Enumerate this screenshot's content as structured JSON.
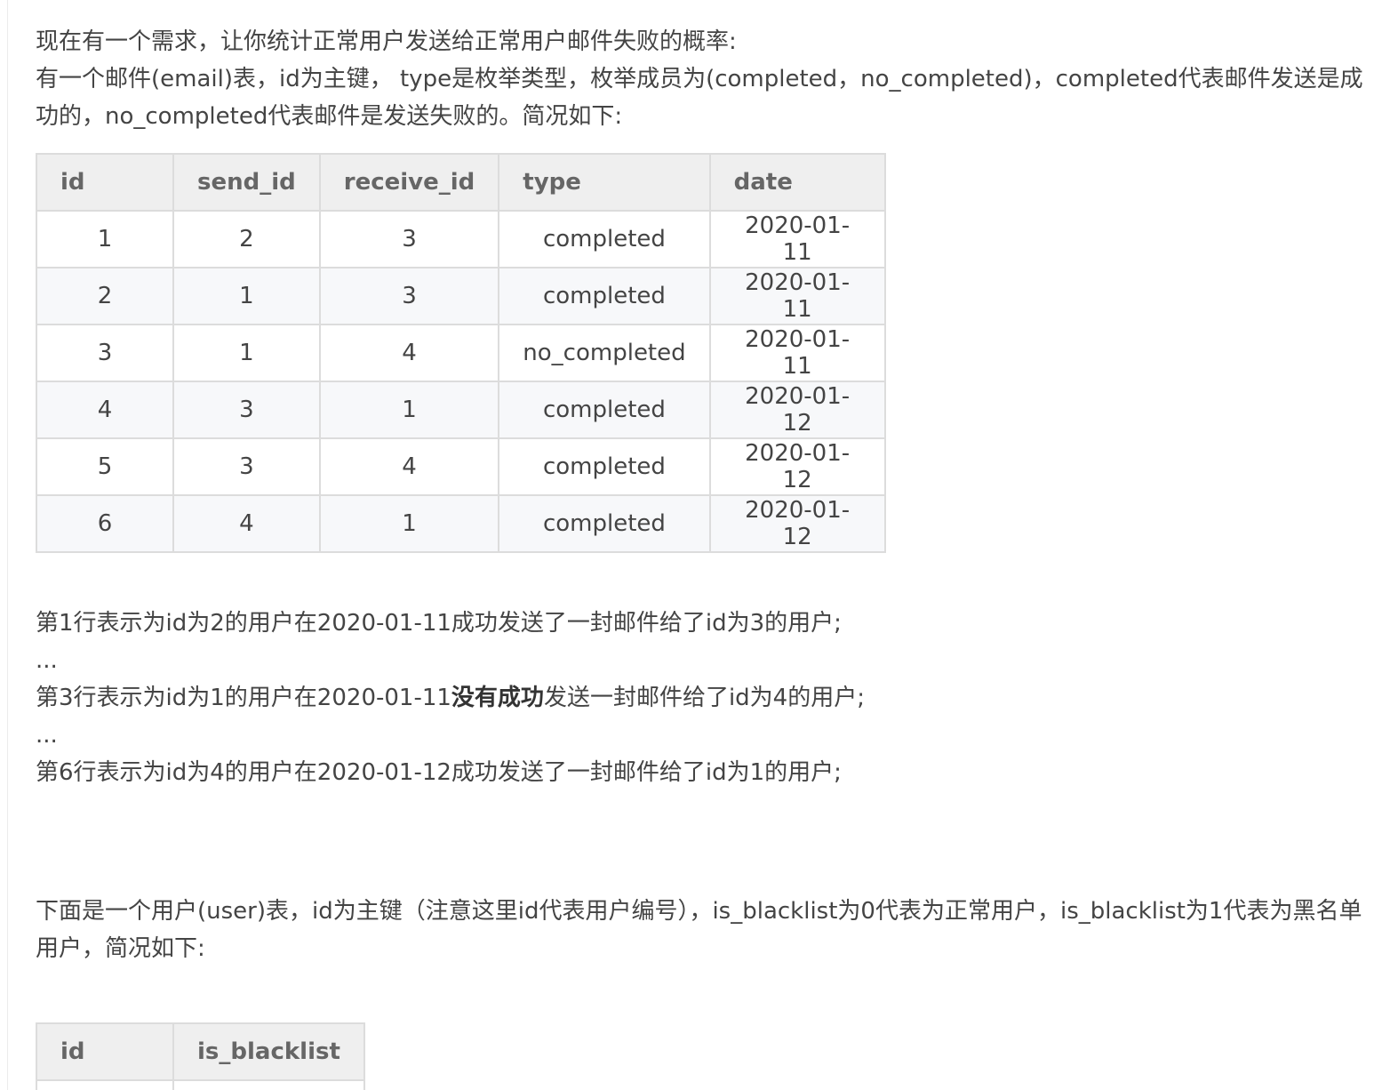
{
  "intro": {
    "line1": "现在有一个需求，让你统计正常用户发送给正常用户邮件失败的概率:",
    "line2": "有一个邮件(email)表，id为主键， type是枚举类型，枚举成员为(completed，no_completed)，completed代表邮件发送是成功的，no_completed代表邮件是发送失败的。简况如下:"
  },
  "email_table": {
    "headers": [
      "id",
      "send_id",
      "receive_id",
      "type",
      "date"
    ],
    "rows": [
      [
        "1",
        "2",
        "3",
        "completed",
        "2020-01-11"
      ],
      [
        "2",
        "1",
        "3",
        "completed",
        "2020-01-11"
      ],
      [
        "3",
        "1",
        "4",
        "no_completed",
        "2020-01-11"
      ],
      [
        "4",
        "3",
        "1",
        "completed",
        "2020-01-12"
      ],
      [
        "5",
        "3",
        "4",
        "completed",
        "2020-01-12"
      ],
      [
        "6",
        "4",
        "1",
        "completed",
        "2020-01-12"
      ]
    ]
  },
  "notes": {
    "row1": "第1行表示为id为2的用户在2020-01-11成功发送了一封邮件给了id为3的用户;",
    "ellipsis1": "...",
    "row3_prefix": "第3行表示为id为1的用户在2020-01-11",
    "row3_bold": "没有成功",
    "row3_suffix": "发送一封邮件给了id为4的用户;",
    "ellipsis2": "...",
    "row6": "第6行表示为id为4的用户在2020-01-12成功发送了一封邮件给了id为1的用户;"
  },
  "user_intro": {
    "text": "下面是一个用户(user)表，id为主键（注意这里id代表用户编号），is_blacklist为0代表为正常用户，is_blacklist为1代表为黑名单用户，简况如下:"
  },
  "user_table": {
    "headers": [
      "id",
      "is_blacklist"
    ]
  }
}
